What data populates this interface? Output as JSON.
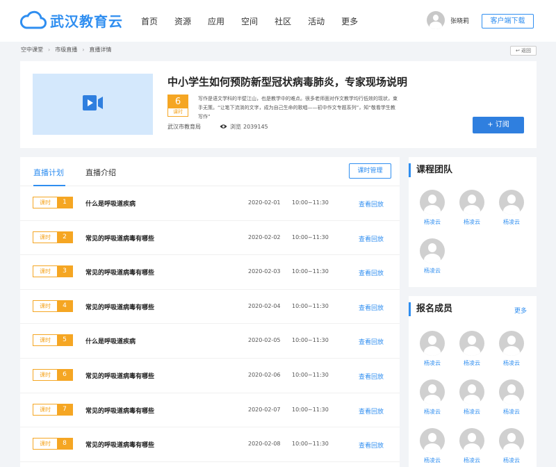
{
  "header": {
    "logo_text": "武汉教育云",
    "nav": [
      "首页",
      "资源",
      "应用",
      "空间",
      "社区",
      "活动",
      "更多"
    ],
    "user_name": "张晓莉",
    "download_label": "客户端下载"
  },
  "breadcrumb": {
    "items": [
      "空中课堂",
      "市级直播",
      "直播详情"
    ],
    "back_label": "返回"
  },
  "course": {
    "title": "中小学生如何预防新型冠状病毒肺炎，专家现场说明",
    "lesson_count": "6",
    "lesson_unit": "课时",
    "description": "写作是语文学科的半壁江山，也是教学中的难点。很多老师面对作文教学均行低效的现状，束手无策。“让笔下流淌的文字，成为自己生命的歌唱——初中作文专题系列”，知“敬看学生教写作”",
    "org": "武汉市教育局",
    "views_label": "浏览",
    "views": "2039145",
    "subscribe_label": "+ 订阅"
  },
  "tabs": {
    "items": [
      "直播计划",
      "直播介绍"
    ],
    "active": 0,
    "manage_label": "课时管理"
  },
  "lessons": [
    {
      "unit": "课时",
      "num": "1",
      "name": "什么是呼吸道疾病",
      "date": "2020-02-01",
      "time": "10:00~11:30",
      "action": "查看回放"
    },
    {
      "unit": "课时",
      "num": "2",
      "name": "常见的呼吸道病毒有哪些",
      "date": "2020-02-02",
      "time": "10:00~11:30",
      "action": "查看回放"
    },
    {
      "unit": "课时",
      "num": "3",
      "name": "常见的呼吸道病毒有哪些",
      "date": "2020-02-03",
      "time": "10:00~11:30",
      "action": "查看回放"
    },
    {
      "unit": "课时",
      "num": "4",
      "name": "常见的呼吸道病毒有哪些",
      "date": "2020-02-04",
      "time": "10:00~11:30",
      "action": "查看回放"
    },
    {
      "unit": "课时",
      "num": "5",
      "name": "什么是呼吸道疾病",
      "date": "2020-02-05",
      "time": "10:00~11:30",
      "action": "查看回放"
    },
    {
      "unit": "课时",
      "num": "6",
      "name": "常见的呼吸道病毒有哪些",
      "date": "2020-02-06",
      "time": "10:00~11:30",
      "action": "查看回放"
    },
    {
      "unit": "课时",
      "num": "7",
      "name": "常见的呼吸道病毒有哪些",
      "date": "2020-02-07",
      "time": "10:00~11:30",
      "action": "查看回放"
    },
    {
      "unit": "课时",
      "num": "8",
      "name": "常见的呼吸道病毒有哪些",
      "date": "2020-02-08",
      "time": "10:00~11:30",
      "action": "查看回放"
    }
  ],
  "team": {
    "title": "课程团队",
    "members": [
      "杨凌云",
      "杨凌云",
      "杨凌云",
      "杨凌云"
    ]
  },
  "enrolled": {
    "title": "报名成员",
    "more_label": "更多",
    "members": [
      "杨凌云",
      "杨凌云",
      "杨凌云",
      "杨凌云",
      "杨凌云",
      "杨凌云",
      "杨凌云",
      "杨凌云",
      "杨凌云"
    ]
  },
  "colors": {
    "accent": "#2f8ef0",
    "badge": "#f5a623",
    "cover_bg": "#d4e8fc"
  }
}
